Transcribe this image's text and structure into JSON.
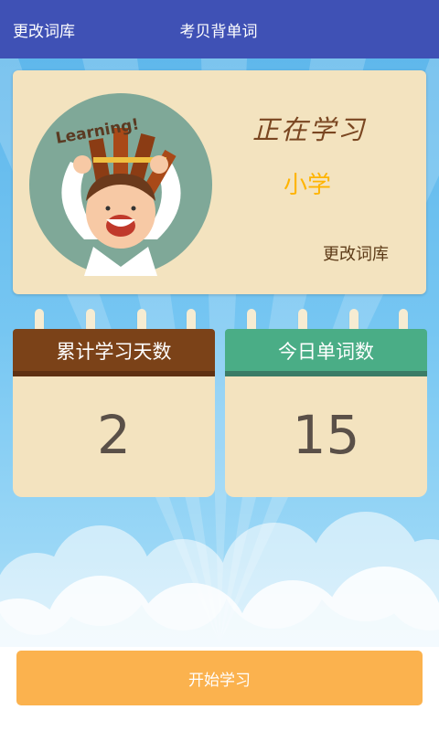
{
  "topbar": {
    "left_action": "更改词库",
    "title": "考贝背单词"
  },
  "learning": {
    "avatar_text": "Learning!",
    "status_label": "正在学习",
    "level": "小学",
    "change_link": "更改词库"
  },
  "stats": {
    "cumulative_days_label": "累计学习天数",
    "cumulative_days_value": "2",
    "today_words_label": "今日单词数",
    "today_words_value": "15"
  },
  "actions": {
    "start_label": "开始学习"
  },
  "colors": {
    "topbar": "#3f51b5",
    "card_beige": "#f3e3bf",
    "brown_header": "#7b4218",
    "green_header": "#4aad86",
    "level_text": "#ffb400",
    "start_button": "#fbb24e"
  }
}
